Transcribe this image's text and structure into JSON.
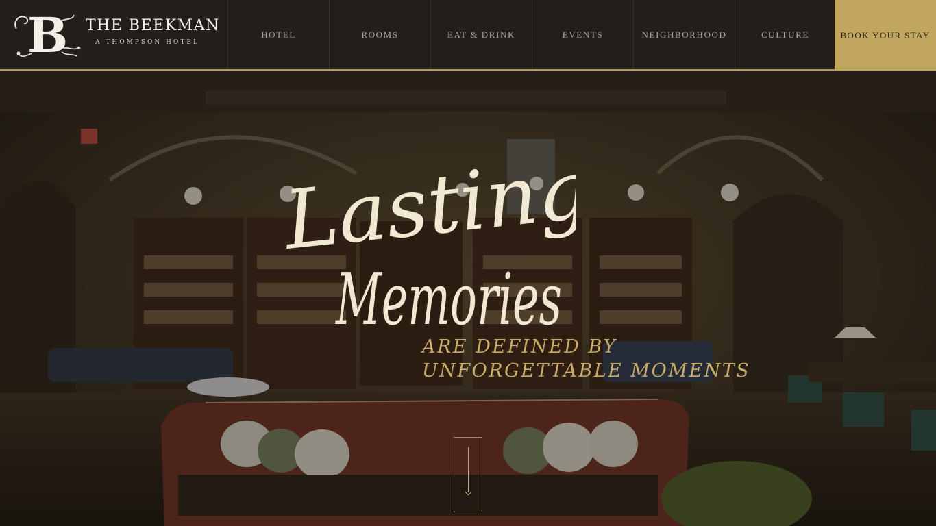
{
  "header": {
    "brand_title": "THE BEEKMAN",
    "brand_subtitle": "A THOMPSON HOTEL",
    "logo_letter": "B",
    "nav": [
      {
        "label": "HOTEL"
      },
      {
        "label": "ROOMS"
      },
      {
        "label": "EAT & DRINK"
      },
      {
        "label": "EVENTS"
      },
      {
        "label": "NEIGHBORHOOD"
      },
      {
        "label": "CULTURE"
      }
    ],
    "cta_label": "BOOK YOUR STAY"
  },
  "hero": {
    "headline_line1": "Lasting",
    "headline_line2": "Memories",
    "tagline_line1": "ARE DEFINED BY",
    "tagline_line2": "UNFORGETTABLE MOMENTS",
    "scroll_icon": "down-arrow-icon"
  },
  "colors": {
    "header_bg": "#211e1b",
    "accent_gold": "#c1a65d",
    "tagline_gold": "#c9ad64",
    "headline_cream": "#f1e8d2",
    "nav_text": "#a8a39b"
  }
}
